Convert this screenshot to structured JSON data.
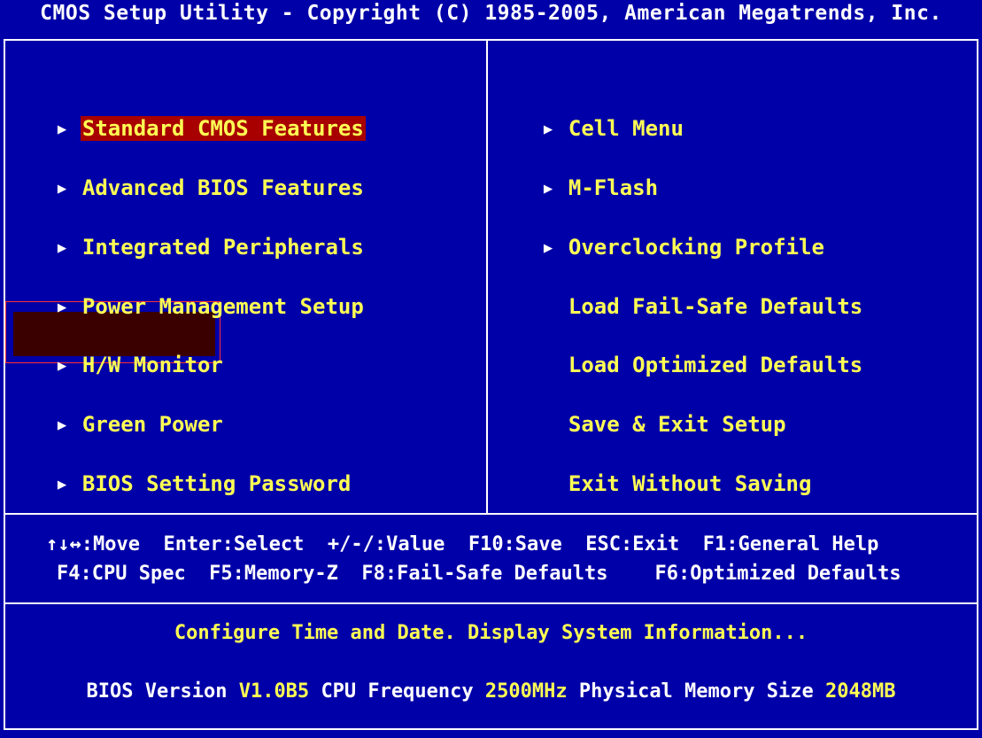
{
  "title": "CMOS Setup Utility - Copyright (C) 1985-2005, American Megatrends, Inc.",
  "left_menu": [
    {
      "label": "Standard CMOS Features",
      "arrow": true
    },
    {
      "label": "Advanced BIOS Features",
      "arrow": true
    },
    {
      "label": "Integrated Peripherals",
      "arrow": true
    },
    {
      "label": "Power Management Setup",
      "arrow": true
    },
    {
      "label": "H/W Monitor",
      "arrow": true
    },
    {
      "label": "Green Power",
      "arrow": true
    },
    {
      "label": "BIOS Setting Password",
      "arrow": true
    }
  ],
  "right_menu": [
    {
      "label": "Cell Menu",
      "arrow": true
    },
    {
      "label": "M-Flash",
      "arrow": true
    },
    {
      "label": "Overclocking Profile",
      "arrow": true
    },
    {
      "label": "Load Fail-Safe Defaults",
      "arrow": false
    },
    {
      "label": "Load Optimized Defaults",
      "arrow": false
    },
    {
      "label": "Save & Exit Setup",
      "arrow": false
    },
    {
      "label": "Exit Without Saving",
      "arrow": false
    }
  ],
  "arrow_glyph": "▶",
  "selected_item": "Standard CMOS Features",
  "hovered_item": "H/W Monitor",
  "help": {
    "line1": "↑↓↔:Move  Enter:Select  +/-/:Value  F10:Save  ESC:Exit  F1:General Help",
    "line2": "F4:CPU Spec  F5:Memory-Z  F8:Fail-Safe Defaults    F6:Optimized Defaults"
  },
  "description": "Configure Time and Date.  Display System Information...",
  "info": {
    "bios_version_label": "BIOS Version",
    "bios_version": "V1.0B5",
    "cpu_freq_label": "CPU Frequency",
    "cpu_freq": "2500MHz",
    "mem_label": "Physical Memory Size",
    "mem_size": "2048MB"
  },
  "colors": {
    "background": "#0000a8",
    "menu_text": "#ffff54",
    "selection": "#a80000",
    "border": "#ffffff"
  }
}
